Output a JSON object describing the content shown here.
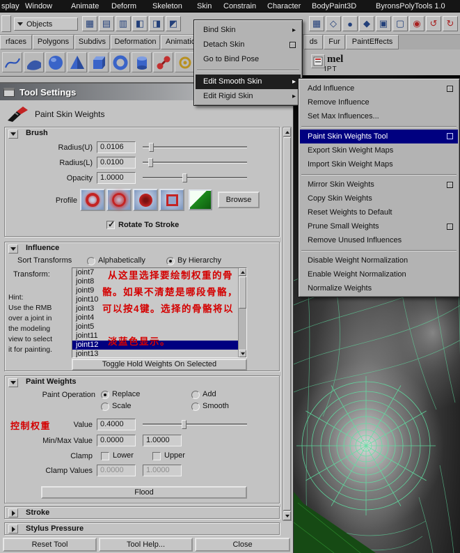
{
  "colors": {
    "selection_navy": "#000080",
    "annotation_red": "#d40000",
    "wireframe_green": "#5fe0a2"
  },
  "menubar": {
    "items": [
      "splay",
      "Window",
      "Animate",
      "Deform",
      "Skeleton",
      "Skin",
      "Constrain",
      "Character",
      "BodyPaint3D",
      "ByronsPolyTools 1.0"
    ]
  },
  "toolbar": {
    "objects_dropdown": "Objects"
  },
  "tabbar": {
    "left_tabs": [
      "rfaces",
      "Polygons",
      "Subdivs",
      "Deformation",
      "Animation"
    ],
    "right_tabs": [
      "ds",
      "Fur",
      "PaintEffects"
    ]
  },
  "shelf": {
    "mel_label": "mel",
    "ipt_label": "IPT"
  },
  "skin_menu": {
    "items": [
      {
        "label": "Bind Skin"
      },
      {
        "label": "Detach Skin"
      },
      {
        "label": "Go to Bind Pose"
      },
      {
        "label": "Edit Smooth Skin"
      },
      {
        "label": "Edit Rigid Skin"
      }
    ]
  },
  "smooth_skin_submenu": {
    "items": [
      {
        "label": "Add Influence"
      },
      {
        "label": "Remove Influence"
      },
      {
        "label": "Set Max Influences..."
      },
      {
        "label": "Paint Skin Weights Tool"
      },
      {
        "label": "Export Skin Weight Maps"
      },
      {
        "label": "Import Skin Weight Maps"
      },
      {
        "label": "Mirror Skin Weights"
      },
      {
        "label": "Copy Skin Weights"
      },
      {
        "label": "Reset Weights to Default"
      },
      {
        "label": "Prune Small Weights"
      },
      {
        "label": "Remove Unused Influences"
      },
      {
        "label": "Disable Weight Normalization"
      },
      {
        "label": "Enable Weight Normalization"
      },
      {
        "label": "Normalize Weights"
      }
    ]
  },
  "tool_settings": {
    "window_title": "Tool Settings",
    "tool_title": "Paint Skin Weights",
    "brush": {
      "section_title": "Brush",
      "radius_u_label": "Radius(U)",
      "radius_u_value": "0.0106",
      "radius_l_label": "Radius(L)",
      "radius_l_value": "0.0100",
      "opacity_label": "Opacity",
      "opacity_value": "1.0000",
      "profile_label": "Profile",
      "browse_button": "Browse",
      "rotate_to_stroke_label": "Rotate To Stroke"
    },
    "influence": {
      "section_title": "Influence",
      "sort_transforms_label": "Sort Transforms",
      "sort_alphabetically": "Alphabetically",
      "sort_by_hierarchy": "By Hierarchy",
      "transform_label": "Transform:",
      "hint_lines": [
        "Hint:",
        "Use the RMB",
        "over a joint in",
        "the modeling",
        "view to select",
        "it for painting."
      ],
      "joints": [
        "joint7",
        "joint8",
        "joint9",
        "joint10",
        "joint3",
        "joint4",
        "joint5",
        "joint11",
        "joint12",
        "joint13"
      ],
      "selected_joint": "joint12",
      "annotation_lines": [
        "从这里选择要绘制权重的骨",
        "骼。如果不清楚是哪段骨骼，",
        "可以按4键。选择的骨骼将以",
        "淡蓝色显示。"
      ],
      "toggle_hold_button": "Toggle Hold Weights On Selected"
    },
    "paint_weights": {
      "section_title": "Paint Weights",
      "paint_operation_label": "Paint Operation",
      "op_replace": "Replace",
      "op_scale": "Scale",
      "op_add": "Add",
      "op_smooth": "Smooth",
      "annotation": "控制权重",
      "value_label": "Value",
      "value": "0.4000",
      "minmax_label": "Min/Max Value",
      "min_value": "0.0000",
      "max_value": "1.0000",
      "clamp_label": "Clamp",
      "clamp_lower": "Lower",
      "clamp_upper": "Upper",
      "clamp_values_label": "Clamp Values",
      "clamp_min": "0.0000",
      "clamp_max": "1.0000",
      "flood_button": "Flood"
    },
    "stroke_section_title": "Stroke",
    "stylus_section_title": "Stylus Pressure",
    "footer": {
      "reset_button": "Reset Tool",
      "help_button": "Tool Help...",
      "close_button": "Close"
    }
  }
}
